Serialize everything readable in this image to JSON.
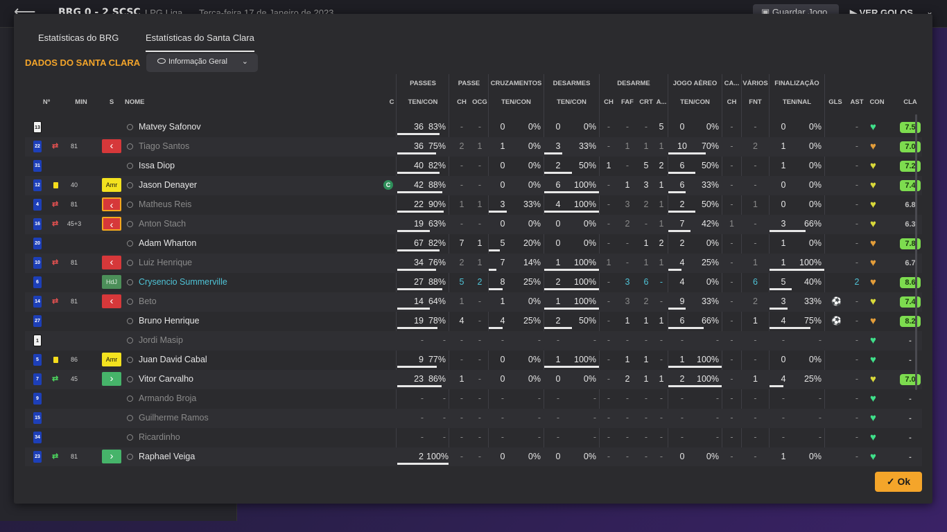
{
  "topbar": {
    "back": "⟵",
    "score": "BRG 0 - 2 SCSC",
    "league": "LPG Liga",
    "date": "Terça-feira 17 de Janeiro de 2023",
    "save_label": "Guardar Jogo",
    "goals_label": "VER GOLOS"
  },
  "tabs": [
    "Estatísticas do BRG",
    "Estatísticas do Santa Clara"
  ],
  "section_title": "DADOS DO SANTA CLARA",
  "dropdown_label": "Informação Geral",
  "ok_label": "Ok",
  "group_headers": [
    "PASSES",
    "PASSE",
    "CRUZAMENTOS",
    "DESARMES",
    "DESARME",
    "JOGO AÉREO",
    "CA...",
    "VÁRIOS",
    "FINALIZAÇÃO"
  ],
  "col_headers": [
    "Nº",
    "MIN",
    "S",
    "NOME",
    "C",
    "TEN/CON",
    "CH",
    "OCG",
    "TEN/CON",
    "TEN/CON",
    "CH",
    "FAF",
    "CRT",
    "A...",
    "TEN/CON",
    "CH",
    "FNT",
    "TEN/NAL",
    "GLS",
    "AST",
    "CON",
    "CLA"
  ],
  "players": [
    {
      "no": "13",
      "gk": true,
      "name": "Matvey Safonov",
      "c": [
        "36",
        "83%",
        "-",
        "-",
        "0",
        "0%",
        "0",
        "0%",
        "-",
        "-",
        "-",
        "5",
        "0",
        "0%",
        "-",
        "-",
        "0",
        "0%",
        "",
        "-"
      ],
      "pass_pct": 83,
      "cross_pct": 0,
      "tackle_pct": 0,
      "air_pct": 0,
      "shot_pct": 0,
      "morale": "very-good",
      "rating": "7.5",
      "bars": [
        1,
        0,
        0,
        0,
        0,
        0
      ]
    },
    {
      "no": "22",
      "sub": "off",
      "min": "81",
      "pos": "sub",
      "dim": true,
      "name": "Tiago Santos",
      "c": [
        "36",
        "75%",
        "2",
        "1",
        "1",
        "0%",
        "3",
        "33%",
        "-",
        "1",
        "1",
        "1",
        "10",
        "70%",
        "-",
        "2",
        "1",
        "0%",
        "",
        "-"
      ],
      "pass_pct": 75,
      "cross_pct": 0,
      "tackle_pct": 33,
      "air_pct": 70,
      "shot_pct": 0,
      "morale": "okay",
      "rating": "7.0",
      "bars": [
        1,
        0,
        0,
        1,
        1,
        0
      ]
    },
    {
      "no": "31",
      "name": "Issa Diop",
      "c": [
        "40",
        "82%",
        "-",
        "-",
        "0",
        "0%",
        "2",
        "50%",
        "1",
        "-",
        "5",
        "2",
        "6",
        "50%",
        "-",
        "-",
        "1",
        "0%",
        "",
        "-"
      ],
      "pass_pct": 82,
      "cross_pct": 0,
      "tackle_pct": 50,
      "air_pct": 50,
      "shot_pct": 0,
      "morale": "good",
      "rating": "7.2",
      "bars": [
        1,
        0,
        0,
        1,
        1,
        0
      ]
    },
    {
      "no": "12",
      "card": true,
      "min": "40",
      "pos": "amr",
      "name": "Jason Denayer",
      "captain": true,
      "c": [
        "42",
        "88%",
        "-",
        "-",
        "0",
        "0%",
        "6",
        "100%",
        "-",
        "1",
        "3",
        "1",
        "6",
        "33%",
        "-",
        "-",
        "0",
        "0%",
        "",
        "-"
      ],
      "pass_pct": 88,
      "cross_pct": 0,
      "tackle_pct": 100,
      "air_pct": 33,
      "shot_pct": 0,
      "morale": "good",
      "rating": "7.4",
      "bars": [
        1,
        0,
        0,
        1,
        1,
        0
      ]
    },
    {
      "no": "4",
      "sub": "off",
      "min": "81",
      "pos": "sub",
      "amb": true,
      "dim": true,
      "name": "Matheus Reis",
      "c": [
        "22",
        "90%",
        "1",
        "1",
        "3",
        "33%",
        "4",
        "100%",
        "-",
        "3",
        "2",
        "1",
        "2",
        "50%",
        "-",
        "1",
        "0",
        "0%",
        "",
        "-"
      ],
      "pass_pct": 90,
      "cross_pct": 33,
      "tackle_pct": 100,
      "air_pct": 50,
      "shot_pct": 0,
      "morale": "good",
      "rating": "6.8",
      "bars": [
        1,
        0,
        1,
        1,
        1,
        0
      ]
    },
    {
      "no": "16",
      "sub": "off",
      "min": "45+3",
      "pos": "sub",
      "amb": true,
      "dim": true,
      "name": "Anton Stach",
      "c": [
        "19",
        "63%",
        "-",
        "-",
        "0",
        "0%",
        "0",
        "0%",
        "-",
        "2",
        "-",
        "1",
        "7",
        "42%",
        "1",
        "-",
        "3",
        "66%",
        "",
        "-"
      ],
      "pass_pct": 63,
      "cross_pct": 0,
      "tackle_pct": 0,
      "air_pct": 42,
      "shot_pct": 66,
      "morale": "good",
      "rating": "6.3",
      "bars": [
        1,
        0,
        0,
        0,
        1,
        1
      ]
    },
    {
      "no": "20",
      "name": "Adam Wharton",
      "c": [
        "67",
        "82%",
        "7",
        "1",
        "5",
        "20%",
        "0",
        "0%",
        "-",
        "-",
        "1",
        "2",
        "2",
        "0%",
        "-",
        "-",
        "1",
        "0%",
        "",
        "-"
      ],
      "pass_pct": 82,
      "cross_pct": 20,
      "tackle_pct": 0,
      "air_pct": 0,
      "shot_pct": 0,
      "morale": "okay",
      "rating": "7.8",
      "bars": [
        1,
        0,
        1,
        0,
        0,
        0
      ]
    },
    {
      "no": "10",
      "sub": "off",
      "min": "81",
      "pos": "sub",
      "dim": true,
      "name": "Luiz Henrique",
      "c": [
        "34",
        "76%",
        "2",
        "1",
        "7",
        "14%",
        "1",
        "100%",
        "1",
        "-",
        "1",
        "1",
        "4",
        "25%",
        "-",
        "1",
        "1",
        "100%",
        "",
        "-"
      ],
      "pass_pct": 76,
      "cross_pct": 14,
      "tackle_pct": 100,
      "air_pct": 25,
      "shot_pct": 100,
      "morale": "okay",
      "rating": "6.7",
      "bars": [
        1,
        0,
        1,
        1,
        1,
        1
      ]
    },
    {
      "no": "6",
      "pos": "hdl",
      "cy": true,
      "name": "Crysencio Summerville",
      "c": [
        "27",
        "88%",
        "5",
        "2",
        "8",
        "25%",
        "2",
        "100%",
        "-",
        "3",
        "6",
        "-",
        "4",
        "0%",
        "-",
        "6",
        "5",
        "40%",
        "",
        "2"
      ],
      "pass_pct": 88,
      "cross_pct": 25,
      "tackle_pct": 100,
      "air_pct": 0,
      "shot_pct": 40,
      "morale": "okay",
      "rating": "8.6",
      "bars": [
        1,
        0,
        1,
        1,
        0,
        1
      ]
    },
    {
      "no": "14",
      "sub": "off",
      "min": "81",
      "pos": "sub",
      "dim": true,
      "ball": true,
      "name": "Beto",
      "c": [
        "14",
        "64%",
        "1",
        "-",
        "1",
        "0%",
        "1",
        "100%",
        "-",
        "3",
        "2",
        "-",
        "9",
        "33%",
        "-",
        "2",
        "3",
        "33%",
        "⚽",
        "-"
      ],
      "pass_pct": 64,
      "cross_pct": 0,
      "tackle_pct": 100,
      "air_pct": 33,
      "shot_pct": 33,
      "morale": "good",
      "rating": "7.4",
      "bars": [
        1,
        0,
        0,
        1,
        1,
        1
      ]
    },
    {
      "no": "27",
      "ball": true,
      "name": "Bruno Henrique",
      "c": [
        "19",
        "78%",
        "4",
        "-",
        "4",
        "25%",
        "2",
        "50%",
        "-",
        "1",
        "1",
        "1",
        "6",
        "66%",
        "-",
        "1",
        "4",
        "75%",
        "⚽",
        "-"
      ],
      "pass_pct": 78,
      "cross_pct": 25,
      "tackle_pct": 50,
      "air_pct": 66,
      "shot_pct": 75,
      "morale": "okay",
      "rating": "8.2",
      "bars": [
        1,
        0,
        1,
        1,
        1,
        1
      ]
    },
    {
      "no": "1",
      "gk": true,
      "dim": true,
      "name": "Jordi Masip",
      "c": [
        "-",
        "-",
        "-",
        "-",
        "-",
        "-",
        "-",
        "-",
        "-",
        "-",
        "-",
        "-",
        "-",
        "-",
        "-",
        "-",
        "-",
        "-",
        "",
        "-"
      ],
      "morale": "very-good",
      "rating": "-",
      "bars": [
        0,
        0,
        0,
        0,
        0,
        0
      ]
    },
    {
      "no": "5",
      "card": true,
      "min": "86",
      "pos": "amr",
      "name": "Juan David Cabal",
      "c": [
        "9",
        "77%",
        "-",
        "-",
        "0",
        "0%",
        "1",
        "100%",
        "-",
        "1",
        "1",
        "-",
        "1",
        "100%",
        "-",
        "-",
        "0",
        "0%",
        "",
        "-"
      ],
      "pass_pct": 77,
      "cross_pct": 0,
      "tackle_pct": 100,
      "air_pct": 100,
      "shot_pct": 0,
      "morale": "very-good",
      "rating": "-",
      "bars": [
        1,
        0,
        0,
        1,
        1,
        0
      ]
    },
    {
      "no": "7",
      "sub": "on",
      "min": "45",
      "pos": "subin",
      "name": "Vitor Carvalho",
      "c": [
        "23",
        "86%",
        "1",
        "-",
        "0",
        "0%",
        "0",
        "0%",
        "-",
        "2",
        "1",
        "1",
        "2",
        "100%",
        "-",
        "1",
        "4",
        "25%",
        "",
        "-"
      ],
      "pass_pct": 86,
      "cross_pct": 0,
      "tackle_pct": 0,
      "air_pct": 100,
      "shot_pct": 25,
      "morale": "good",
      "rating": "7.0",
      "bars": [
        1,
        0,
        0,
        0,
        1,
        1
      ]
    },
    {
      "no": "9",
      "dim": true,
      "name": "Armando Broja",
      "c": [
        "-",
        "-",
        "-",
        "-",
        "-",
        "-",
        "-",
        "-",
        "-",
        "-",
        "-",
        "-",
        "-",
        "-",
        "-",
        "-",
        "-",
        "-",
        "",
        "-"
      ],
      "morale": "very-good",
      "rating": "-",
      "bars": [
        0,
        0,
        0,
        0,
        0,
        0
      ]
    },
    {
      "no": "15",
      "dim": true,
      "name": "Guilherme Ramos",
      "c": [
        "-",
        "-",
        "-",
        "-",
        "-",
        "-",
        "-",
        "-",
        "-",
        "-",
        "-",
        "-",
        "-",
        "-",
        "-",
        "-",
        "-",
        "-",
        "",
        "-"
      ],
      "morale": "very-good",
      "rating": "-",
      "bars": [
        0,
        0,
        0,
        0,
        0,
        0
      ]
    },
    {
      "no": "34",
      "dim": true,
      "name": "Ricardinho",
      "c": [
        "-",
        "-",
        "-",
        "-",
        "-",
        "-",
        "-",
        "-",
        "-",
        "-",
        "-",
        "-",
        "-",
        "-",
        "-",
        "-",
        "-",
        "-",
        "",
        "-"
      ],
      "morale": "very-good",
      "rating": "-",
      "bars": [
        0,
        0,
        0,
        0,
        0,
        0
      ]
    },
    {
      "no": "23",
      "sub": "on",
      "min": "81",
      "pos": "subin",
      "name": "Raphael Veiga",
      "c": [
        "2",
        "100%",
        "-",
        "-",
        "0",
        "0%",
        "0",
        "0%",
        "-",
        "-",
        "-",
        "-",
        "0",
        "0%",
        "-",
        "-",
        "1",
        "0%",
        "",
        "-"
      ],
      "pass_pct": 100,
      "cross_pct": 0,
      "tackle_pct": 0,
      "air_pct": 0,
      "shot_pct": 0,
      "morale": "very-good",
      "rating": "-",
      "bars": [
        1,
        0,
        0,
        0,
        0,
        0
      ]
    }
  ],
  "pos_labels": {
    "amr": "Amr",
    "hdl": "HdJ",
    "sub": "‹",
    "subin": "›"
  },
  "colors": {
    "accent": "#f4a52a",
    "rating_high": "#7ddc4f",
    "sub_off": "#d6383a",
    "sub_on": "#46b46a",
    "highlight": "#4fc3d6"
  },
  "icons": {
    "back": "arrow-left-icon",
    "eye": "eye-icon",
    "chevron": "chevron-down-icon",
    "morale": "heart-icon",
    "goal": "football-icon",
    "captain": "captain-badge-icon"
  }
}
